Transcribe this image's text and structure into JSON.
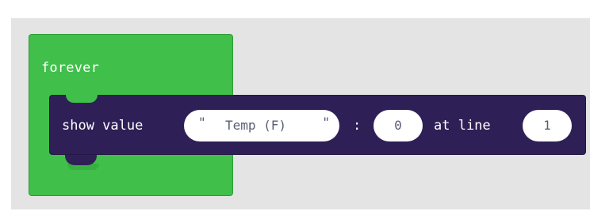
{
  "blocks": {
    "forever": {
      "label": "forever",
      "color": "#40bf4a"
    },
    "show_value": {
      "label": "show value",
      "color": "#2e2056",
      "open_quote": "\"",
      "string_value": "Temp (F)",
      "close_quote": "\"",
      "separator": ":",
      "value": "0",
      "at_line_label": "at line",
      "line": "1"
    }
  }
}
